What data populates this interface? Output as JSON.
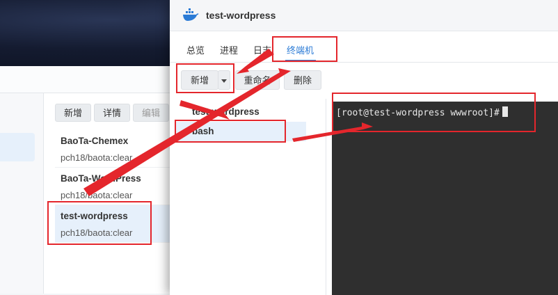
{
  "background_window": {
    "toolbar": {
      "new_label": "新增",
      "detail_label": "详情",
      "edit_label": "编辑"
    },
    "containers": [
      {
        "name": "BaoTa-Chemex",
        "image": "pch18/baota:clear"
      },
      {
        "name": "BaoTa-WordPress",
        "image": "pch18/baota:clear"
      },
      {
        "name": "test-wordpress",
        "image": "pch18/baota:clear"
      }
    ]
  },
  "window": {
    "title": "test-wordpress",
    "tabs": [
      {
        "label": "总览"
      },
      {
        "label": "进程"
      },
      {
        "label": "日志"
      },
      {
        "label": "终端机",
        "active": true
      }
    ],
    "toolbar": {
      "new_label": "新增",
      "rename_label": "重命名",
      "delete_label": "删除"
    },
    "sessions": [
      {
        "label": "test-wordpress"
      },
      {
        "label": "bash",
        "selected": true
      }
    ],
    "terminal": {
      "prompt": "[root@test-wordpress wwwroot]#"
    }
  },
  "colors": {
    "accent": "#2b7bd6",
    "annotation": "#e4262c",
    "terminal_bg": "#2f2f2f"
  }
}
